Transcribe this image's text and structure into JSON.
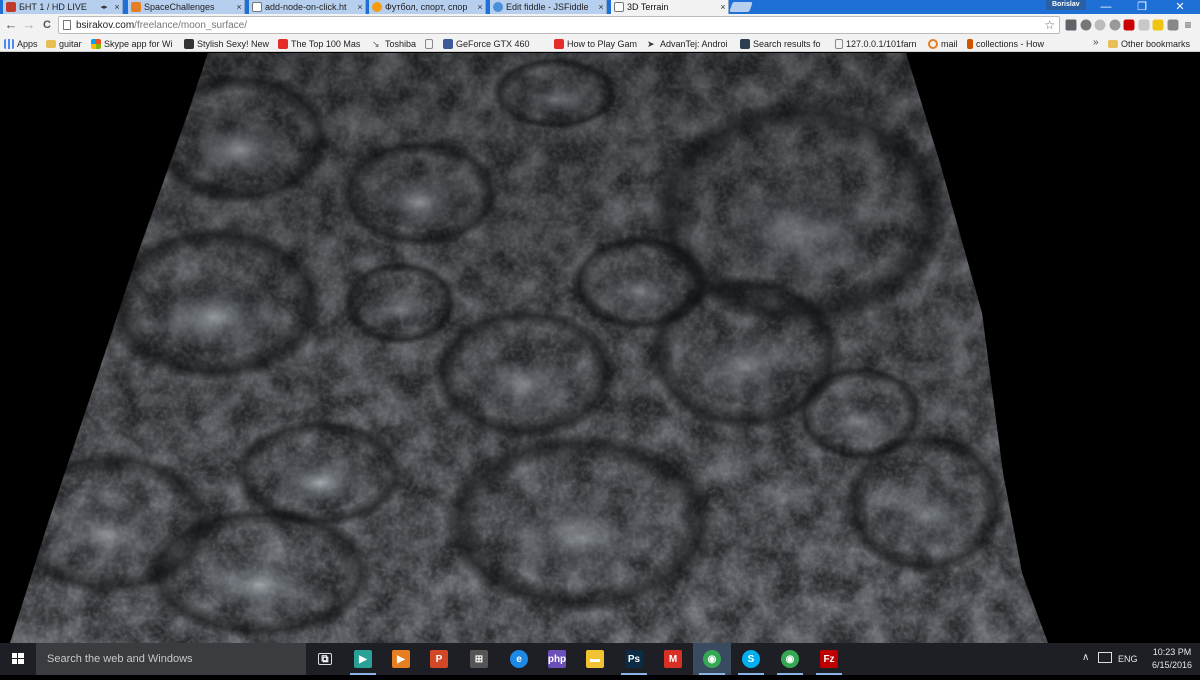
{
  "browser": {
    "tabs": [
      {
        "title": "БНТ 1 / HD LIVE",
        "favicon_color": "#c0392b",
        "extra": "◂▸"
      },
      {
        "title": "SpaceChallenges",
        "favicon_color": "#e67e22"
      },
      {
        "title": "add-node-on-click.ht",
        "favicon_color": "#ffffff"
      },
      {
        "title": "Футбол, спорт, спор",
        "favicon_color": "#f39c12"
      },
      {
        "title": "Edit fiddle - JSFiddle",
        "favicon_color": "#4a90d9"
      },
      {
        "title": "3D Terrain",
        "favicon_color": "#ffffff"
      }
    ],
    "active_tab_index": 5,
    "tab_close_glyph": "×",
    "profile_name": "Borislav",
    "window_buttons": {
      "minimize": "—",
      "maximize": "❐",
      "close": "✕"
    },
    "nav": {
      "back": "←",
      "forward": "→",
      "reload": "C"
    },
    "url": {
      "domain": "bsirakov.com",
      "path": "/freelance/moon_surface/"
    },
    "star_glyph": "☆",
    "menu_glyph": "≡",
    "extensions": [
      {
        "icon": "cast-icon",
        "color": "#5f6368"
      },
      {
        "icon": "ext-gray-icon",
        "color": "#777777"
      },
      {
        "icon": "ext-lightgray-icon",
        "color": "#bbbbbb"
      },
      {
        "icon": "ext-gray2-icon",
        "color": "#999999"
      },
      {
        "icon": "ext-red-icon",
        "color": "#cc0000"
      },
      {
        "icon": "ext-slim-icon",
        "color": "#c8c8c8"
      },
      {
        "icon": "ext-yellow-icon",
        "color": "#f1c40f"
      },
      {
        "icon": "ext-stripe-icon",
        "color": "#888888"
      }
    ]
  },
  "bookmarks": {
    "items": [
      {
        "label": "Apps",
        "icon": "apps-grid-icon",
        "color": "#4a8af4"
      },
      {
        "label": "guitar",
        "icon": "folder-icon",
        "color": "#e8bf54"
      },
      {
        "label": "Skype app for Wi",
        "icon": "windows-flag-icon",
        "color": "#f25022"
      },
      {
        "label": "Stylish Sexy! New",
        "icon": "bookmark-icon",
        "color": "#333333"
      },
      {
        "label": "The Top 100 Mas",
        "icon": "youtube-icon",
        "color": "#e52d27"
      },
      {
        "label": "Toshiba",
        "icon": "toshiba-icon",
        "color": "#555555"
      },
      {
        "label": "",
        "icon": "page-icon",
        "color": "#888888"
      },
      {
        "label": "GeForce GTX 460",
        "icon": "facebook-icon",
        "color": "#3b5998"
      },
      {
        "label": "How to Play Gam",
        "icon": "youtube-icon",
        "color": "#e52d27"
      },
      {
        "label": "AdvanTej: Androi",
        "icon": "advantej-icon",
        "color": "#333333"
      },
      {
        "label": "Search results fo",
        "icon": "search-results-icon",
        "color": "#2c3e50"
      },
      {
        "label": "127.0.0.1/101farn",
        "icon": "page-icon",
        "color": "#888888"
      },
      {
        "label": "mail",
        "icon": "mail-icon",
        "color": "#e67e22"
      },
      {
        "label": "collections - How",
        "icon": "collections-icon",
        "color": "#d35400"
      }
    ],
    "overflow_glyph": "»",
    "other_bookmarks": "Other bookmarks"
  },
  "taskbar": {
    "search_placeholder": "Search the web and Windows",
    "apps": [
      {
        "name": "task-view-icon",
        "glyph": "⧉",
        "color": "#1d1f24",
        "running": false
      },
      {
        "name": "app-arrow-icon",
        "glyph": "▶",
        "color": "#2aa198",
        "running": true
      },
      {
        "name": "media-player-icon",
        "glyph": "▶",
        "color": "#e67e22",
        "running": false
      },
      {
        "name": "powerpoint-icon",
        "glyph": "P",
        "color": "#d24726",
        "running": false
      },
      {
        "name": "store-icon",
        "glyph": "⊞",
        "color": "#555555",
        "running": false
      },
      {
        "name": "edge-icon",
        "glyph": "e",
        "color": "#1e88e5",
        "running": false
      },
      {
        "name": "phpstorm-icon",
        "glyph": "php",
        "color": "#6b4fbb",
        "running": false
      },
      {
        "name": "file-explorer-icon",
        "glyph": "▬",
        "color": "#f1c232",
        "running": false
      },
      {
        "name": "photoshop-icon",
        "glyph": "Ps",
        "color": "#0c2b44",
        "running": true
      },
      {
        "name": "gmail-icon",
        "glyph": "M",
        "color": "#d93025",
        "running": false
      },
      {
        "name": "chrome-icon",
        "glyph": "◉",
        "color": "#34a853",
        "running": true
      },
      {
        "name": "skype-icon",
        "glyph": "S",
        "color": "#00aff0",
        "running": true
      },
      {
        "name": "chrome-icon-2",
        "glyph": "◉",
        "color": "#34a853",
        "running": true
      },
      {
        "name": "filezilla-icon",
        "glyph": "Fz",
        "color": "#bf0000",
        "running": true
      }
    ],
    "tray": {
      "chevron": "∧",
      "language": "ENG",
      "time": "10:23 PM",
      "date": "6/15/2016"
    }
  },
  "colors": {
    "tab_strip": "#1e6fd6",
    "terrain_base": "#2c2e31",
    "crater_highlight": "#b9c0c8",
    "taskbar": "#1d1f24"
  }
}
